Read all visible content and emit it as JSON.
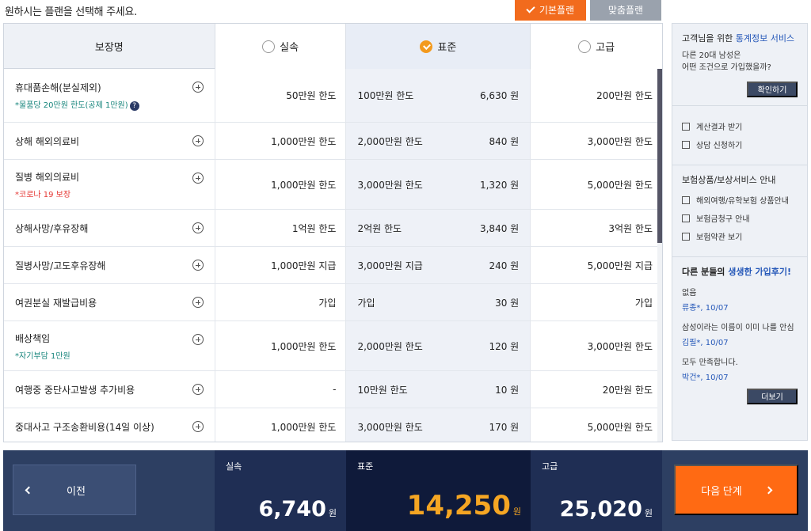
{
  "header": {
    "instruction": "원하시는 플랜을 선택해 주세요.",
    "basic_plan": "기본플랜",
    "custom_plan": "맞춤플랜"
  },
  "table": {
    "col_name": "보장명",
    "plans": [
      "실속",
      "표준",
      "고급"
    ],
    "selected_plan": "표준",
    "rows": [
      {
        "name": "휴대품손해(분실제외)",
        "sub": "*물품당 20만원 한도(공제 1만원)",
        "sub_color": "green",
        "help": true,
        "v1": "50만원 한도",
        "v2": "100만원 한도",
        "price": "6,630 원",
        "v3": "200만원 한도",
        "h": 68
      },
      {
        "name": "상해 해외의료비",
        "sub": "",
        "v1": "1,000만원 한도",
        "v2": "2,000만원 한도",
        "price": "840 원",
        "v3": "3,000만원 한도",
        "h": 47
      },
      {
        "name": "질병 해외의료비",
        "sub": "*코로나 19 보장",
        "sub_color": "red",
        "v1": "1,000만원 한도",
        "v2": "3,000만원 한도",
        "price": "1,320 원",
        "v3": "5,000만원 한도",
        "h": 63
      },
      {
        "name": "상해사망/후유장해",
        "sub": "",
        "v1": "1억원 한도",
        "v2": "2억원 한도",
        "price": "3,840 원",
        "v3": "3억원 한도",
        "h": 47
      },
      {
        "name": "질병사망/고도후유장해",
        "sub": "",
        "v1": "1,000만원 지급",
        "v2": "3,000만원 지급",
        "price": "240 원",
        "v3": "5,000만원 지급",
        "h": 47
      },
      {
        "name": "여권분실 재발급비용",
        "sub": "",
        "v1": "가입",
        "v2": "가입",
        "price": "30 원",
        "v3": "가입",
        "h": 47
      },
      {
        "name": "배상책임",
        "sub": "*자기부담 1만원",
        "sub_color": "green",
        "v1": "1,000만원 한도",
        "v2": "2,000만원 한도",
        "price": "120 원",
        "v3": "3,000만원 한도",
        "h": 63
      },
      {
        "name": "여행중 중단사고발생 추가비용",
        "sub": "",
        "v1": "-",
        "v2": "10만원 한도",
        "price": "10 원",
        "v3": "20만원 한도",
        "h": 47
      },
      {
        "name": "중대사고 구조송환비용(14일 이상)",
        "sub": "",
        "v1": "1,000만원 한도",
        "v2": "3,000만원 한도",
        "price": "170 원",
        "v3": "5,000만원 한도",
        "h": 47
      }
    ]
  },
  "side": {
    "stats_title_pre": "고객님을 위한",
    "stats_title_link": "통계정보 서비스",
    "stats_desc1": "다른 20대 남성은",
    "stats_desc2": "어떤 조건으로 가입했을까?",
    "confirm": "확인하기",
    "links1": [
      {
        "label": "계산결과 받기",
        "icon": "mail-icon"
      },
      {
        "label": "상담 신청하기",
        "icon": "edit-icon"
      }
    ],
    "guide_title": "보험상품/보상서비스 안내",
    "links2": [
      {
        "label": "해외여행/유학보험 상품안내",
        "icon": "bag-icon"
      },
      {
        "label": "보험금청구 안내",
        "icon": "clipboard-icon"
      },
      {
        "label": "보험약관 보기",
        "icon": "document-icon"
      }
    ],
    "review_pre": "다른 분들의",
    "review_link": "생생한 가입후기!",
    "reviews": [
      {
        "comment": "없음",
        "author": "류종*, 10/07"
      },
      {
        "comment": "삼성이라는 이름이 이미 나를 안심",
        "author": "김필*, 10/07"
      },
      {
        "comment": "모두 만족합니다.",
        "author": "박건*, 10/07"
      }
    ],
    "more": "더보기"
  },
  "footer": {
    "prev": "이전",
    "next": "다음 단계",
    "totals": [
      {
        "plan": "실속",
        "amount": "6,740",
        "unit": "원"
      },
      {
        "plan": "표준",
        "amount": "14,250",
        "unit": "원"
      },
      {
        "plan": "고급",
        "amount": "25,020",
        "unit": "원"
      }
    ]
  }
}
